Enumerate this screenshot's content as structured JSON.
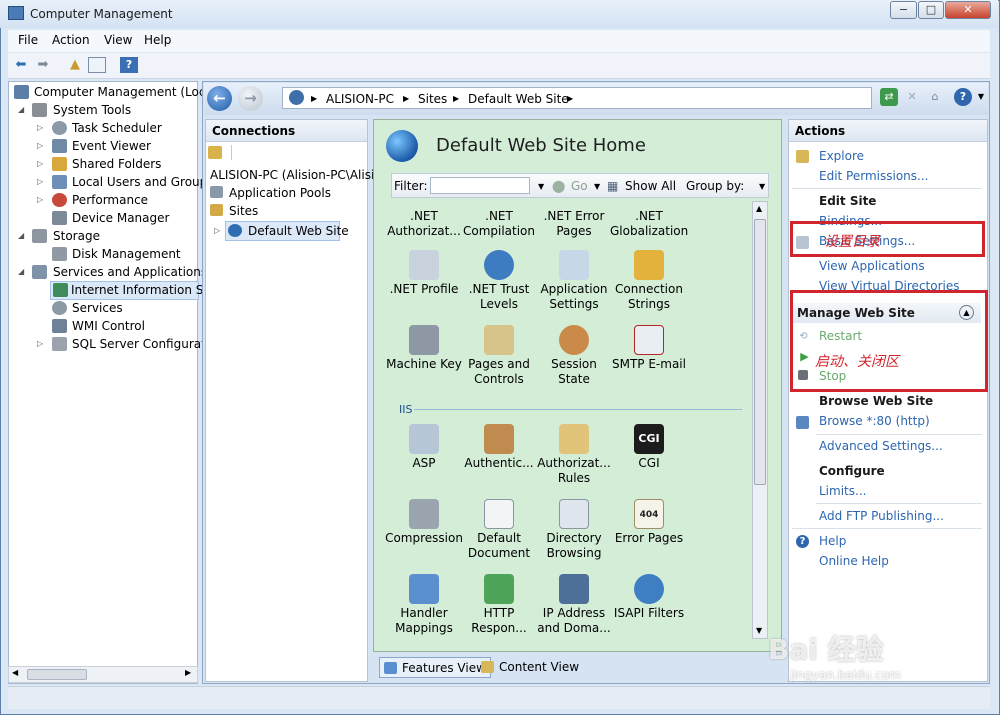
{
  "window": {
    "title": "Computer Management",
    "min": "−",
    "max": "□",
    "close": "✕"
  },
  "menu": [
    "File",
    "Action",
    "View",
    "Help"
  ],
  "tree": {
    "root": "Computer Management (Local",
    "system_tools": "System Tools",
    "task_scheduler": "Task Scheduler",
    "event_viewer": "Event Viewer",
    "shared_folders": "Shared Folders",
    "local_users": "Local Users and Groups",
    "performance": "Performance",
    "device_manager": "Device Manager",
    "storage": "Storage",
    "disk_management": "Disk Management",
    "services_apps": "Services and Applications",
    "iis": "Internet Information Ser",
    "services": "Services",
    "wmi": "WMI Control",
    "sql": "SQL Server Configuratic"
  },
  "address": {
    "crumbs": [
      "ALISION-PC",
      "Sites",
      "Default Web Site"
    ],
    "sep": "▶"
  },
  "connections": {
    "header": "Connections",
    "server": "ALISION-PC (Alision-PC\\Alisi",
    "app_pools": "Application Pools",
    "sites": "Sites",
    "default_site": "Default Web Site"
  },
  "center": {
    "title": "Default Web Site Home",
    "filter_label": "Filter:",
    "go": "Go",
    "show_all": "Show All",
    "group_by": "Group by:",
    "iis_label": "IIS",
    "aspnet_top": [
      {
        "l1": ".NET",
        "l2": "Authorizat..."
      },
      {
        "l1": ".NET",
        "l2": "Compilation"
      },
      {
        "l1": ".NET Error",
        "l2": "Pages"
      },
      {
        "l1": ".NET",
        "l2": "Globalization"
      }
    ],
    "row2": [
      {
        "l1": ".NET Profile",
        "l2": "",
        "icon": "profile-icon"
      },
      {
        "l1": ".NET Trust",
        "l2": "Levels",
        "icon": "trust-icon"
      },
      {
        "l1": "Application",
        "l2": "Settings",
        "icon": "app-settings-icon"
      },
      {
        "l1": "Connection",
        "l2": "Strings",
        "icon": "connection-strings-icon"
      }
    ],
    "row3": [
      {
        "l1": "Machine Key",
        "l2": "",
        "icon": "machine-key-icon"
      },
      {
        "l1": "Pages and",
        "l2": "Controls",
        "icon": "pages-controls-icon"
      },
      {
        "l1": "Session State",
        "l2": "",
        "icon": "session-state-icon"
      },
      {
        "l1": "SMTP E-mail",
        "l2": "",
        "icon": "smtp-icon"
      }
    ],
    "row4": [
      {
        "l1": "ASP",
        "l2": "",
        "icon": "asp-icon"
      },
      {
        "l1": "Authentic...",
        "l2": "",
        "icon": "authentication-icon"
      },
      {
        "l1": "Authorizat...",
        "l2": "Rules",
        "icon": "authorization-rules-icon"
      },
      {
        "l1": "CGI",
        "l2": "",
        "icon": "cgi-icon",
        "glyph": "CGI"
      }
    ],
    "row5": [
      {
        "l1": "Compression",
        "l2": "",
        "icon": "compression-icon"
      },
      {
        "l1": "Default",
        "l2": "Document",
        "icon": "default-document-icon"
      },
      {
        "l1": "Directory",
        "l2": "Browsing",
        "icon": "directory-browsing-icon"
      },
      {
        "l1": "Error Pages",
        "l2": "",
        "icon": "error-pages-icon",
        "glyph": "404"
      }
    ],
    "row6": [
      {
        "l1": "Handler",
        "l2": "Mappings",
        "icon": "handler-mappings-icon"
      },
      {
        "l1": "HTTP",
        "l2": "Respon...",
        "icon": "http-response-icon"
      },
      {
        "l1": "IP Address",
        "l2": "and Doma...",
        "icon": "ip-address-icon"
      },
      {
        "l1": "ISAPI Filters",
        "l2": "",
        "icon": "isapi-filters-icon"
      }
    ],
    "features_view": "Features View",
    "content_view": "Content View"
  },
  "actions": {
    "header": "Actions",
    "explore": "Explore",
    "edit_permissions": "Edit Permissions...",
    "edit_site": "Edit Site",
    "bindings": "Bindings...",
    "basic_settings": "Basic Settings...",
    "view_applications": "View Applications",
    "view_virtual_dirs": "View Virtual Directories",
    "manage_header": "Manage Web Site",
    "restart": "Restart",
    "start": "Start",
    "stop": "Stop",
    "browse_header": "Browse Web Site",
    "browse80": "Browse *:80 (http)",
    "advanced": "Advanced Settings...",
    "configure": "Configure",
    "limits": "Limits...",
    "add_ftp": "Add FTP Publishing...",
    "help": "Help",
    "online_help": "Online Help"
  },
  "annotations": {
    "set_dir": "设置目录",
    "start_close": "启动、关闭区"
  },
  "watermark": {
    "main": "Bai 经验",
    "sub": "jingyan.baidu.com"
  },
  "colors": {
    "annotation_red": "#d0252d",
    "link_blue": "#2c66b0",
    "feature_bg": "#d3edd7"
  }
}
